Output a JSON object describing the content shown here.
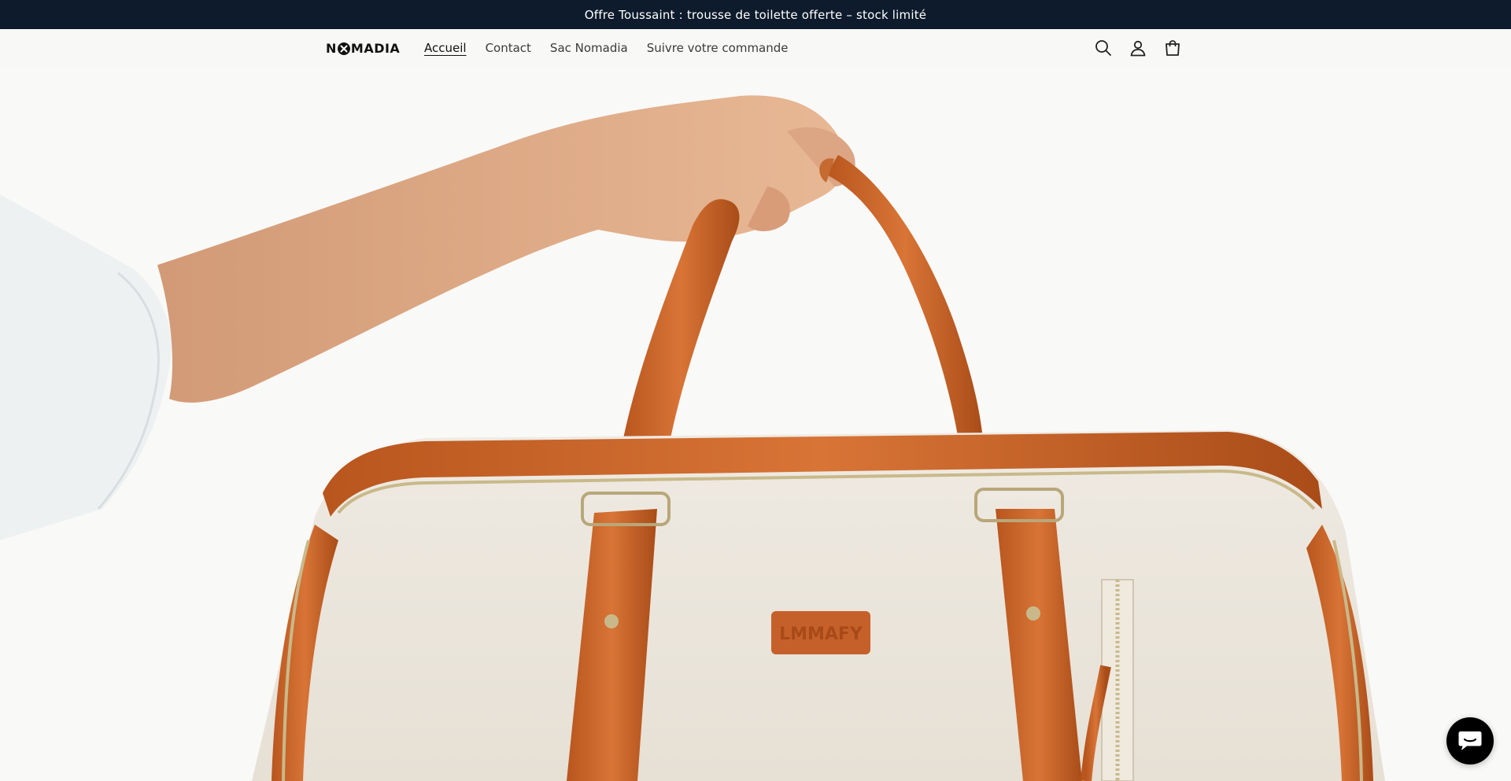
{
  "announcement": {
    "text": "Offre Toussaint : trousse de toilette offerte – stock limité"
  },
  "header": {
    "logo_left": "N",
    "logo_right": "MADIA",
    "nav": [
      {
        "label": "Accueil",
        "active": true
      },
      {
        "label": "Contact",
        "active": false
      },
      {
        "label": "Sac Nomadia",
        "active": false
      },
      {
        "label": "Suivre votre commande",
        "active": false
      }
    ],
    "icons": [
      "search-icon",
      "account-icon",
      "cart-icon"
    ]
  },
  "hero": {
    "image": "hand holding cream canvas duffel bag with tan leather straps",
    "bag_patch_text": "LMMAFY"
  },
  "chat": {
    "icon": "chat-icon"
  },
  "colors": {
    "announcement_bg": "#0e1b2c",
    "page_bg": "#f8f8f6",
    "leather": "#c8642a",
    "canvas": "#ece6db"
  }
}
